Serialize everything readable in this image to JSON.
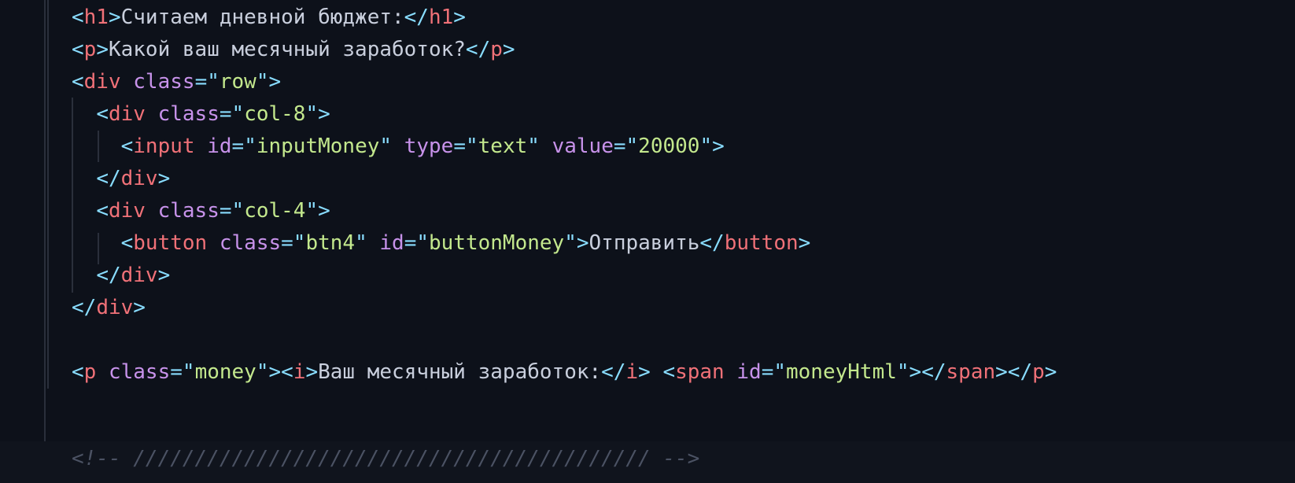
{
  "editor": {
    "language": "html",
    "theme_colors": {
      "background": "#0d111a",
      "punctuation": "#89ddff",
      "tag": "#f07178",
      "attribute": "#c792ea",
      "string": "#c3e88d",
      "text": "#c9cfdd",
      "comment": "#4b5263"
    },
    "lines": {
      "l1": {
        "tag": "h1",
        "text": "Считаем дневной бюджет:"
      },
      "l2": {
        "tag": "p",
        "text": "Какой ваш месячный заработок?"
      },
      "l3": {
        "tag": "div",
        "attr1": "class",
        "val1": "row"
      },
      "l4": {
        "tag": "div",
        "attr1": "class",
        "val1": "col-8"
      },
      "l5": {
        "tag": "input",
        "attr1": "id",
        "val1": "inputMoney",
        "attr2": "type",
        "val2": "text",
        "attr3": "value",
        "val3": "20000"
      },
      "l6": {
        "tag": "div"
      },
      "l7": {
        "tag": "div",
        "attr1": "class",
        "val1": "col-4"
      },
      "l8": {
        "tag": "button",
        "attr1": "class",
        "val1": "btn4",
        "attr2": "id",
        "val2": "buttonMoney",
        "text": "Отправить"
      },
      "l9": {
        "tag": "div"
      },
      "l10": {
        "tag": "div"
      },
      "l12": {
        "tag": "p",
        "attr1": "class",
        "val1": "money",
        "itag": "i",
        "itext": "Ваш месячный заработок:",
        "stag": "span",
        "sattr": "id",
        "sval": "moneyHtml"
      },
      "l14": {
        "comment": "<!-- ////////////////////////////////////////// -->"
      }
    }
  }
}
